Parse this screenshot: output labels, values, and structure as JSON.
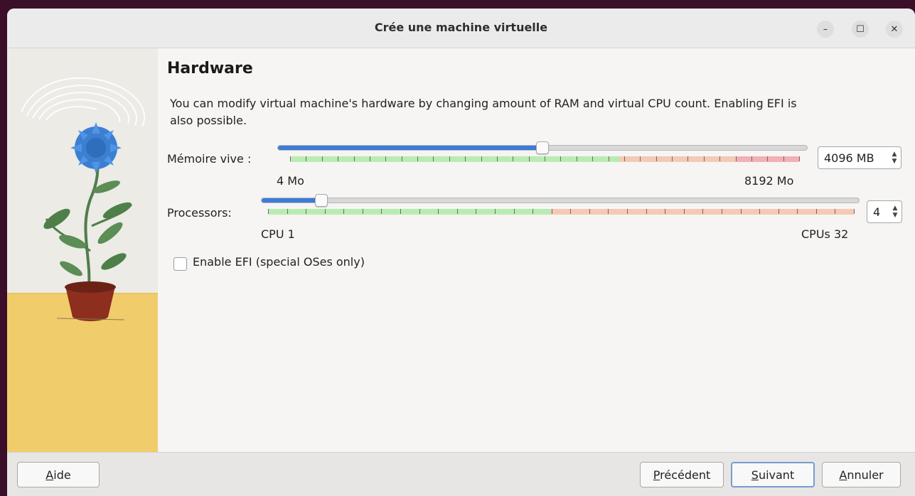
{
  "window": {
    "title": "Crée une machine virtuelle"
  },
  "controls": {
    "minimize": "–",
    "maximize": "☐",
    "close": "✕"
  },
  "page": {
    "heading": "Hardware",
    "description": "You can modify virtual machine's hardware by changing amount of RAM and virtual CPU count. Enabling EFI is also possible."
  },
  "memory": {
    "label": "Mémoire vive :",
    "min_label": "4 Mo",
    "max_label": "8192 Mo",
    "value_text": "4096 MB",
    "fraction": 0.5
  },
  "processors": {
    "label": "Processors:",
    "min_label": "CPU 1",
    "max_label": "CPUs 32",
    "value_text": "4",
    "fraction": 0.1
  },
  "efi": {
    "label": "Enable EFI (special OSes only)",
    "checked": false
  },
  "buttons": {
    "help": "Aide",
    "back": "Précédent",
    "next": "Suivant",
    "cancel": "Annuler"
  },
  "colors": {
    "slider_fill": "#3d7bd6",
    "zone_ok": "#b9ecb3",
    "zone_warn": "#f6c8b6",
    "zone_bad": "#f3b0b3"
  }
}
